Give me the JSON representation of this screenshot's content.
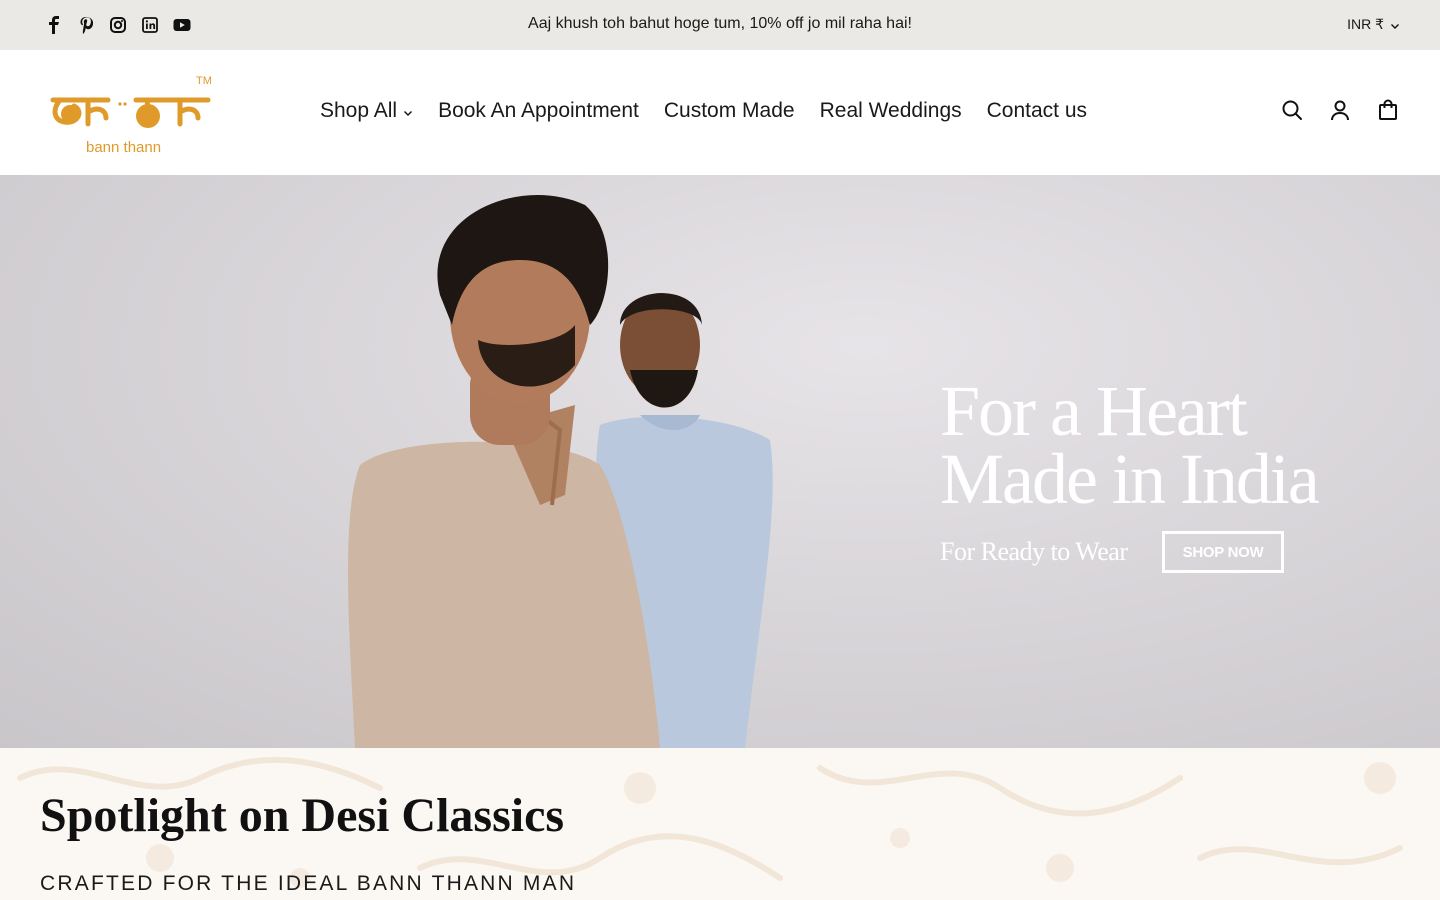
{
  "announcement": {
    "social": [
      {
        "name": "facebook"
      },
      {
        "name": "pinterest"
      },
      {
        "name": "instagram"
      },
      {
        "name": "linkedin"
      },
      {
        "name": "youtube"
      }
    ],
    "text": "Aaj khush toh bahut hoge tum, 10% off jo mil raha hai!",
    "currency": "INR ₹"
  },
  "header": {
    "logo_text": "bann thann",
    "logo_tm": "TM",
    "nav": [
      {
        "label": "Shop All",
        "dropdown": true
      },
      {
        "label": "Book An Appointment"
      },
      {
        "label": "Custom Made"
      },
      {
        "label": "Real Weddings"
      },
      {
        "label": "Contact us"
      }
    ],
    "icons": [
      "search-icon",
      "account-icon",
      "cart-icon"
    ]
  },
  "hero": {
    "heading_line1": "For a Heart",
    "heading_line2": "Made in India",
    "subtext": "For Ready to Wear",
    "button": "SHOP NOW"
  },
  "spotlight": {
    "title": "Spotlight on Desi Classics",
    "subtitle": "CRAFTED FOR THE IDEAL BANN THANN MAN"
  },
  "colors": {
    "announcement_bg": "#ebe9e6",
    "brand_orange": "#e09a2a",
    "hero_bg": "#d9d6da",
    "spotlight_bg": "#fbf8f4"
  }
}
